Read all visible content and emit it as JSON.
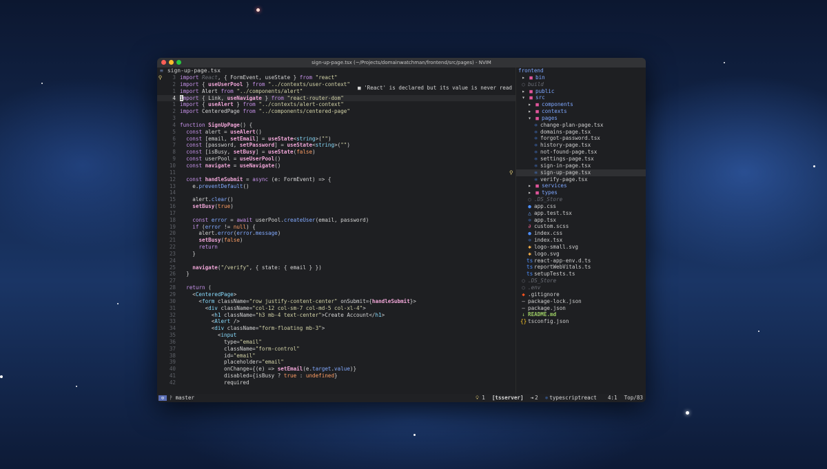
{
  "window": {
    "title": "sign-up-page.tsx (~/Projects/domainwatchman/frontend/src/pages) - NVIM"
  },
  "editor": {
    "buffer_name": "sign-up-page.tsx",
    "diagnostic": "■ 'React' is declared but its value is never read",
    "lines": [
      {
        "sign": "bulb",
        "n": "3"
      },
      {
        "sign": "",
        "n": "2"
      },
      {
        "sign": "",
        "n": "1"
      },
      {
        "sign": "",
        "n": "4",
        "current": true
      },
      {
        "sign": "",
        "n": "1"
      },
      {
        "sign": "",
        "n": "2"
      },
      {
        "sign": "",
        "n": "3"
      },
      {
        "sign": "",
        "n": "4"
      },
      {
        "sign": "",
        "n": "5"
      },
      {
        "sign": "",
        "n": "6"
      },
      {
        "sign": "",
        "n": "7"
      },
      {
        "sign": "",
        "n": "8"
      },
      {
        "sign": "",
        "n": "9"
      },
      {
        "sign": "",
        "n": "10"
      },
      {
        "sign": "",
        "n": "11"
      },
      {
        "sign": "",
        "n": "12"
      },
      {
        "sign": "",
        "n": "13"
      },
      {
        "sign": "",
        "n": "14"
      },
      {
        "sign": "",
        "n": "15"
      },
      {
        "sign": "",
        "n": "16"
      },
      {
        "sign": "",
        "n": "17"
      },
      {
        "sign": "",
        "n": "18"
      },
      {
        "sign": "",
        "n": "19"
      },
      {
        "sign": "",
        "n": "20"
      },
      {
        "sign": "",
        "n": "21"
      },
      {
        "sign": "",
        "n": "22"
      },
      {
        "sign": "",
        "n": "23"
      },
      {
        "sign": "",
        "n": "24"
      },
      {
        "sign": "",
        "n": "25"
      },
      {
        "sign": "",
        "n": "26"
      },
      {
        "sign": "",
        "n": "27"
      },
      {
        "sign": "",
        "n": "28"
      },
      {
        "sign": "",
        "n": "29"
      },
      {
        "sign": "",
        "n": "30"
      },
      {
        "sign": "",
        "n": "31"
      },
      {
        "sign": "",
        "n": "32"
      },
      {
        "sign": "",
        "n": "33"
      },
      {
        "sign": "",
        "n": "34"
      },
      {
        "sign": "",
        "n": "35"
      },
      {
        "sign": "",
        "n": "36"
      },
      {
        "sign": "",
        "n": "37"
      },
      {
        "sign": "",
        "n": "38"
      },
      {
        "sign": "",
        "n": "39"
      },
      {
        "sign": "",
        "n": "40"
      },
      {
        "sign": "",
        "n": "41"
      },
      {
        "sign": "",
        "n": "42"
      }
    ],
    "code": [
      "import React, { FormEvent, useState } from \"react\"",
      "import { useUserPool } from \"../contexts/user-context\"",
      "import Alert from \"../components/alert\"",
      "import { Link, useNavigate } from \"react-router-dom\"",
      "import { useAlert } from \"../contexts/alert-context\"",
      "import CenteredPage from \"../components/centered-page\"",
      "",
      "function SignUpPage() {",
      "  const alert = useAlert()",
      "  const [email, setEmail] = useState<string>(\"\")",
      "  const [password, setPassword] = useState<string>(\"\")",
      "  const [isBusy, setBusy] = useState(false)",
      "  const userPool = useUserPool()",
      "  const navigate = useNavigate()",
      "",
      "  const handleSubmit = async (e: FormEvent) => {",
      "    e.preventDefault()",
      "",
      "    alert.clear()",
      "    setBusy(true)",
      "",
      "    const error = await userPool.createUser(email, password)",
      "    if (error != null) {",
      "      alert.error(error.message)",
      "      setBusy(false)",
      "      return",
      "    }",
      "",
      "    navigate(\"/verify\", { state: { email } })",
      "  }",
      "",
      "  return (",
      "    <CenteredPage>",
      "      <form className=\"row justify-content-center\" onSubmit={handleSubmit}>",
      "        <div className=\"col-12 col-sm-7 col-md-5 col-xl-4\">",
      "          <h1 className=\"h3 mb-4 text-center\">Create Account</h1>",
      "          <Alert />",
      "          <div className=\"form-floating mb-3\">",
      "            <input",
      "              type=\"email\"",
      "              className=\"form-control\"",
      "              id=\"email\"",
      "              placeholder=\"email\"",
      "              onChange={(e) => setEmail(e.target.value)}",
      "              disabled={isBusy ? true : undefined}",
      "              required"
    ]
  },
  "tree": {
    "root": "frontend",
    "items": [
      {
        "indent": 0,
        "icon": "▸",
        "color": "#e0559b",
        "label": "bin",
        "kind": "folder"
      },
      {
        "indent": 0,
        "icon": "○",
        "color": "#6b6e76",
        "label": "build",
        "kind": "ignored"
      },
      {
        "indent": 0,
        "icon": "▸",
        "color": "#e0559b",
        "label": "public",
        "kind": "folder"
      },
      {
        "indent": 0,
        "icon": "▾",
        "color": "#e0559b",
        "label": "src",
        "kind": "folder"
      },
      {
        "indent": 1,
        "icon": "▸",
        "color": "#e0559b",
        "label": "components",
        "kind": "folder"
      },
      {
        "indent": 1,
        "icon": "▸",
        "color": "#e0559b",
        "label": "contexts",
        "kind": "folder"
      },
      {
        "indent": 1,
        "icon": "▾",
        "color": "#e0559b",
        "label": "pages",
        "kind": "folder"
      },
      {
        "indent": 2,
        "icon": "⚛",
        "color": "#4d8fff",
        "label": "change-plan-page.tsx",
        "kind": "file"
      },
      {
        "indent": 2,
        "icon": "⚛",
        "color": "#4d8fff",
        "label": "domains-page.tsx",
        "kind": "file"
      },
      {
        "indent": 2,
        "icon": "⚛",
        "color": "#4d8fff",
        "label": "forgot-password.tsx",
        "kind": "file"
      },
      {
        "indent": 2,
        "icon": "⚛",
        "color": "#4d8fff",
        "label": "history-page.tsx",
        "kind": "file"
      },
      {
        "indent": 2,
        "icon": "⚛",
        "color": "#4d8fff",
        "label": "not-found-page.tsx",
        "kind": "file"
      },
      {
        "indent": 2,
        "icon": "⚛",
        "color": "#4d8fff",
        "label": "settings-page.tsx",
        "kind": "file"
      },
      {
        "indent": 2,
        "icon": "⚛",
        "color": "#4d8fff",
        "label": "sign-in-page.tsx",
        "kind": "file"
      },
      {
        "indent": 2,
        "icon": "⚛",
        "color": "#4d8fff",
        "label": "sign-up-page.tsx",
        "kind": "file",
        "selected": true
      },
      {
        "indent": 2,
        "icon": "⚛",
        "color": "#4d8fff",
        "label": "verify-page.tsx",
        "kind": "file"
      },
      {
        "indent": 1,
        "icon": "▸",
        "color": "#e0559b",
        "label": "services",
        "kind": "folder"
      },
      {
        "indent": 1,
        "icon": "▸",
        "color": "#e0559b",
        "label": "types",
        "kind": "folder"
      },
      {
        "indent": 1,
        "icon": "○",
        "color": "#6b6e76",
        "label": ".DS_Store",
        "kind": "ignored"
      },
      {
        "indent": 1,
        "icon": "●",
        "color": "#4d8fff",
        "label": "app.css",
        "kind": "file"
      },
      {
        "indent": 1,
        "icon": "△",
        "color": "#6fa8ff",
        "label": "app.test.tsx",
        "kind": "file"
      },
      {
        "indent": 1,
        "icon": "⚛",
        "color": "#4d8fff",
        "label": "app.tsx",
        "kind": "file"
      },
      {
        "indent": 1,
        "icon": "∂",
        "color": "#f06292",
        "label": "custom.scss",
        "kind": "file"
      },
      {
        "indent": 1,
        "icon": "●",
        "color": "#4d8fff",
        "label": "index.css",
        "kind": "file"
      },
      {
        "indent": 1,
        "icon": "⚛",
        "color": "#4d8fff",
        "label": "index.tsx",
        "kind": "file"
      },
      {
        "indent": 1,
        "icon": "✱",
        "color": "#ffb74d",
        "label": "logo-small.svg",
        "kind": "file"
      },
      {
        "indent": 1,
        "icon": "✱",
        "color": "#ffb74d",
        "label": "logo.svg",
        "kind": "file"
      },
      {
        "indent": 1,
        "icon": "ts",
        "color": "#4d8fff",
        "label": "react-app-env.d.ts",
        "kind": "file"
      },
      {
        "indent": 1,
        "icon": "ts",
        "color": "#4d8fff",
        "label": "reportWebVitals.ts",
        "kind": "file"
      },
      {
        "indent": 1,
        "icon": "ts",
        "color": "#4d8fff",
        "label": "setupTests.ts",
        "kind": "file"
      },
      {
        "indent": 0,
        "icon": "○",
        "color": "#6b6e76",
        "label": ".DS_Store",
        "kind": "ignored"
      },
      {
        "indent": 0,
        "icon": "○",
        "color": "#6b6e76",
        "label": ".env",
        "kind": "ignored"
      },
      {
        "indent": 0,
        "icon": "◆",
        "color": "#f4511e",
        "label": ".gitignore",
        "kind": "file"
      },
      {
        "indent": 0,
        "icon": "―",
        "color": "#c8c8c8",
        "label": "package-lock.json",
        "kind": "file"
      },
      {
        "indent": 0,
        "icon": "―",
        "color": "#c8c8c8",
        "label": "package.json",
        "kind": "file"
      },
      {
        "indent": 0,
        "icon": "↓",
        "color": "#9ccc65",
        "label": "README.md",
        "kind": "readme"
      },
      {
        "indent": 0,
        "icon": "{}",
        "color": "#ffca28",
        "label": "tsconfig.json",
        "kind": "file"
      }
    ]
  },
  "status": {
    "mode": "⊙",
    "branch": "master",
    "diag_count": "1",
    "lsp": "[tsserver]",
    "warn_count": "2",
    "filetype": "typescriptreact",
    "position": "4:1",
    "scroll": "Top/83"
  }
}
